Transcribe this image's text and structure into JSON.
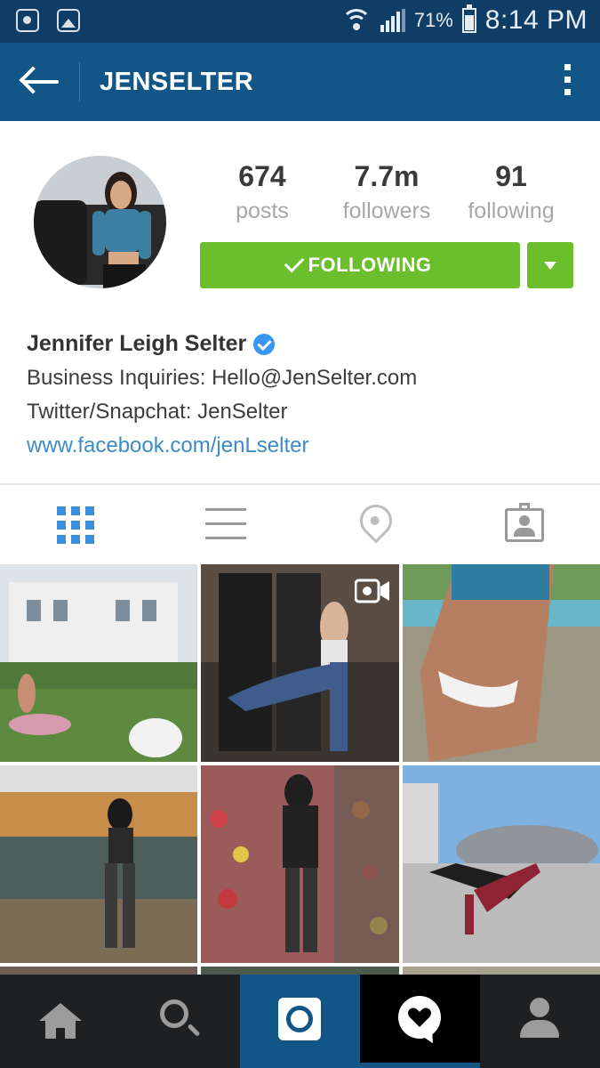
{
  "status_bar": {
    "battery_percent": "71%",
    "time": "8:14 PM",
    "icons": [
      "voicemail-icon",
      "gallery-icon",
      "wifi-icon",
      "signal-icon",
      "battery-icon"
    ]
  },
  "app_bar": {
    "title": "JENSELTER",
    "icons": [
      "back-arrow-icon",
      "overflow-menu-icon"
    ]
  },
  "profile": {
    "stats": [
      {
        "value": "674",
        "label": "posts"
      },
      {
        "value": "7.7m",
        "label": "followers"
      },
      {
        "value": "91",
        "label": "following"
      }
    ],
    "follow_button_label": "FOLLOWING",
    "button_color": "#6bbf2d"
  },
  "bio": {
    "name": "Jennifer Leigh Selter",
    "verified": true,
    "lines": [
      "Business Inquiries: Hello@JenSelter.com",
      "Twitter/Snapchat: JenSelter"
    ],
    "link": "www.facebook.com/jenLselter"
  },
  "view_tabs": {
    "items": [
      "grid-view-icon",
      "list-view-icon",
      "location-pin-icon",
      "tagged-photos-icon"
    ],
    "active": "grid-view-icon",
    "active_color": "#3a8fd8"
  },
  "photos": {
    "count_visible": 6,
    "video_badge_on": 2
  },
  "bottom_nav": {
    "items": [
      "home-icon",
      "search-icon",
      "camera-icon",
      "activity-icon",
      "profile-icon"
    ],
    "active": "activity-icon"
  },
  "colors": {
    "status_bar": "#0f3d66",
    "app_bar": "#125688",
    "link": "#3d8bc6",
    "verified_badge": "#3897f0"
  }
}
